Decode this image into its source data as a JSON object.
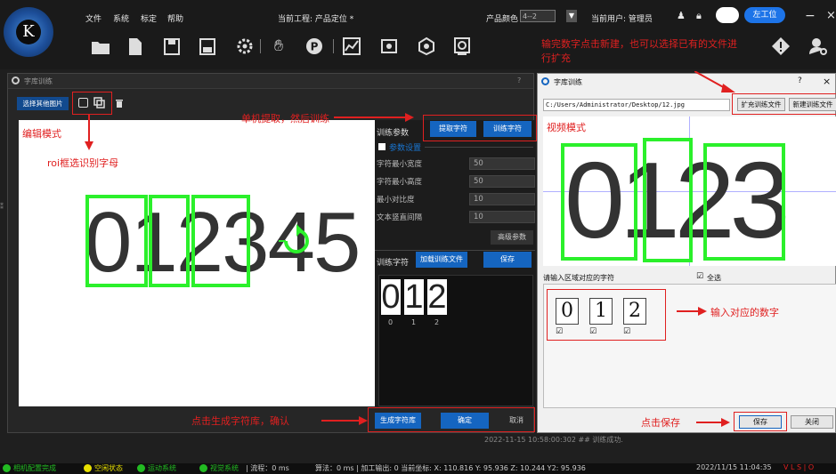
{
  "menu": {
    "file": "文件",
    "system": "系统",
    "calibrate": "标定",
    "help": "帮助"
  },
  "project": "当前工程: 产品定位 *",
  "color_label": "产品颜色",
  "color_value": "4--2",
  "user": "当前用户: 管理员",
  "station_btn": "左工位",
  "win_minimize": "−",
  "win_close": "×",
  "logo_letter": "K",
  "toolbar_icons": [
    "folder-open-icon",
    "new-file-icon",
    "save-icon",
    "save-as-icon",
    "settings-icon",
    "hand-icon",
    "p-icon",
    "chart-icon",
    "camera-icon",
    "3d-icon",
    "target-icon",
    "warning-icon",
    "user-icon"
  ],
  "annotations": {
    "top_right": "输完数字点击新建，也可以选择已有的文件进行扩充",
    "extract": "单机提取，然后训练",
    "edit_mode": "编辑模式",
    "roi": "roi框选识别字母",
    "input_digit": "输入对应的数字",
    "generate": "点击生成字符库，确认",
    "save": "点击保存"
  },
  "dlg1": {
    "title": "字库训练",
    "help": "?",
    "select_image": "选择其他图片",
    "train_params": "训练参数",
    "extract_btn": "提取字符",
    "train_btn": "训练字符",
    "param_setting": "参数设置",
    "params": [
      {
        "label": "字符最小宽度",
        "value": "50"
      },
      {
        "label": "字符最小高度",
        "value": "50"
      },
      {
        "label": "最小对比度",
        "value": "10"
      },
      {
        "label": "文本竖直间隔",
        "value": "10"
      }
    ],
    "advanced": "高级参数",
    "train_chars": "训练字符",
    "load_file": "加载训练文件",
    "save": "保存",
    "digits": [
      "0",
      "1",
      "2",
      "3",
      "4",
      "5"
    ],
    "thumbs": [
      {
        "char": "0",
        "label": "0"
      },
      {
        "char": "1",
        "label": "1"
      },
      {
        "char": "2",
        "label": "2"
      }
    ],
    "gen_lib": "生成字符库",
    "confirm": "确定",
    "cancel": "取消"
  },
  "log": "2022-11-15 10:58:00:302 ## 训练成功.",
  "dlg2": {
    "title": "字库训练",
    "help": "?",
    "close": "×",
    "path": "C:/Users/Administrator/Desktop/12.jpg",
    "expand_btn": "扩充训练文件",
    "new_btn": "新建训练文件",
    "video_mode": "视频模式",
    "digits": [
      "0",
      "1",
      "2",
      "3"
    ],
    "input_label": "请输入区域对应的字符",
    "select_all": "全选",
    "chars": [
      "0",
      "1",
      "2"
    ],
    "save": "保存",
    "close_btn": "关闭"
  },
  "status": {
    "items": [
      {
        "label": "相机配置完成",
        "color": "#22bb22"
      },
      {
        "label": "空闲状态",
        "color": "#e8e000"
      },
      {
        "label": "运动系统",
        "color": "#22bb22"
      },
      {
        "label": "视觉系统",
        "color": "#22bb22"
      }
    ],
    "flow": "| 流程：0 ms",
    "algo": "算法：0 ms | 加工输出: 0  当前坐标: X: 110.816  Y: 95.936  Z: 10.244  Y2: 95.936",
    "datetime": "2022/11/15 11:04:35",
    "tail": "V L S | O"
  },
  "colors": {
    "accent": "#1565c0",
    "annotation": "#e02020",
    "roi": "#2bf02b"
  }
}
